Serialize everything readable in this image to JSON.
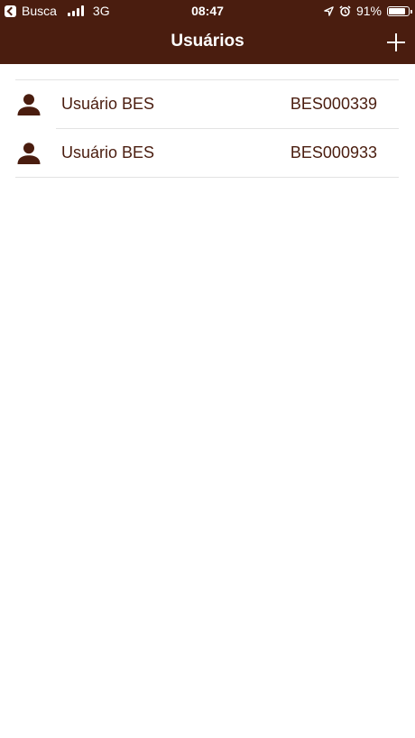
{
  "status_bar": {
    "back_app": "Busca",
    "network": "3G",
    "time": "08:47",
    "battery_label": "91%",
    "battery_level": 0.91
  },
  "nav": {
    "title": "Usuários",
    "add_icon": "plus-icon"
  },
  "users": [
    {
      "name": "Usuário BES",
      "code": "BES000339",
      "icon": "person-icon"
    },
    {
      "name": "Usuário BES",
      "code": "BES000933",
      "icon": "person-icon"
    }
  ],
  "colors": {
    "primary": "#4a1d0f",
    "background": "#ffffff",
    "separator": "#e3e3e3"
  }
}
